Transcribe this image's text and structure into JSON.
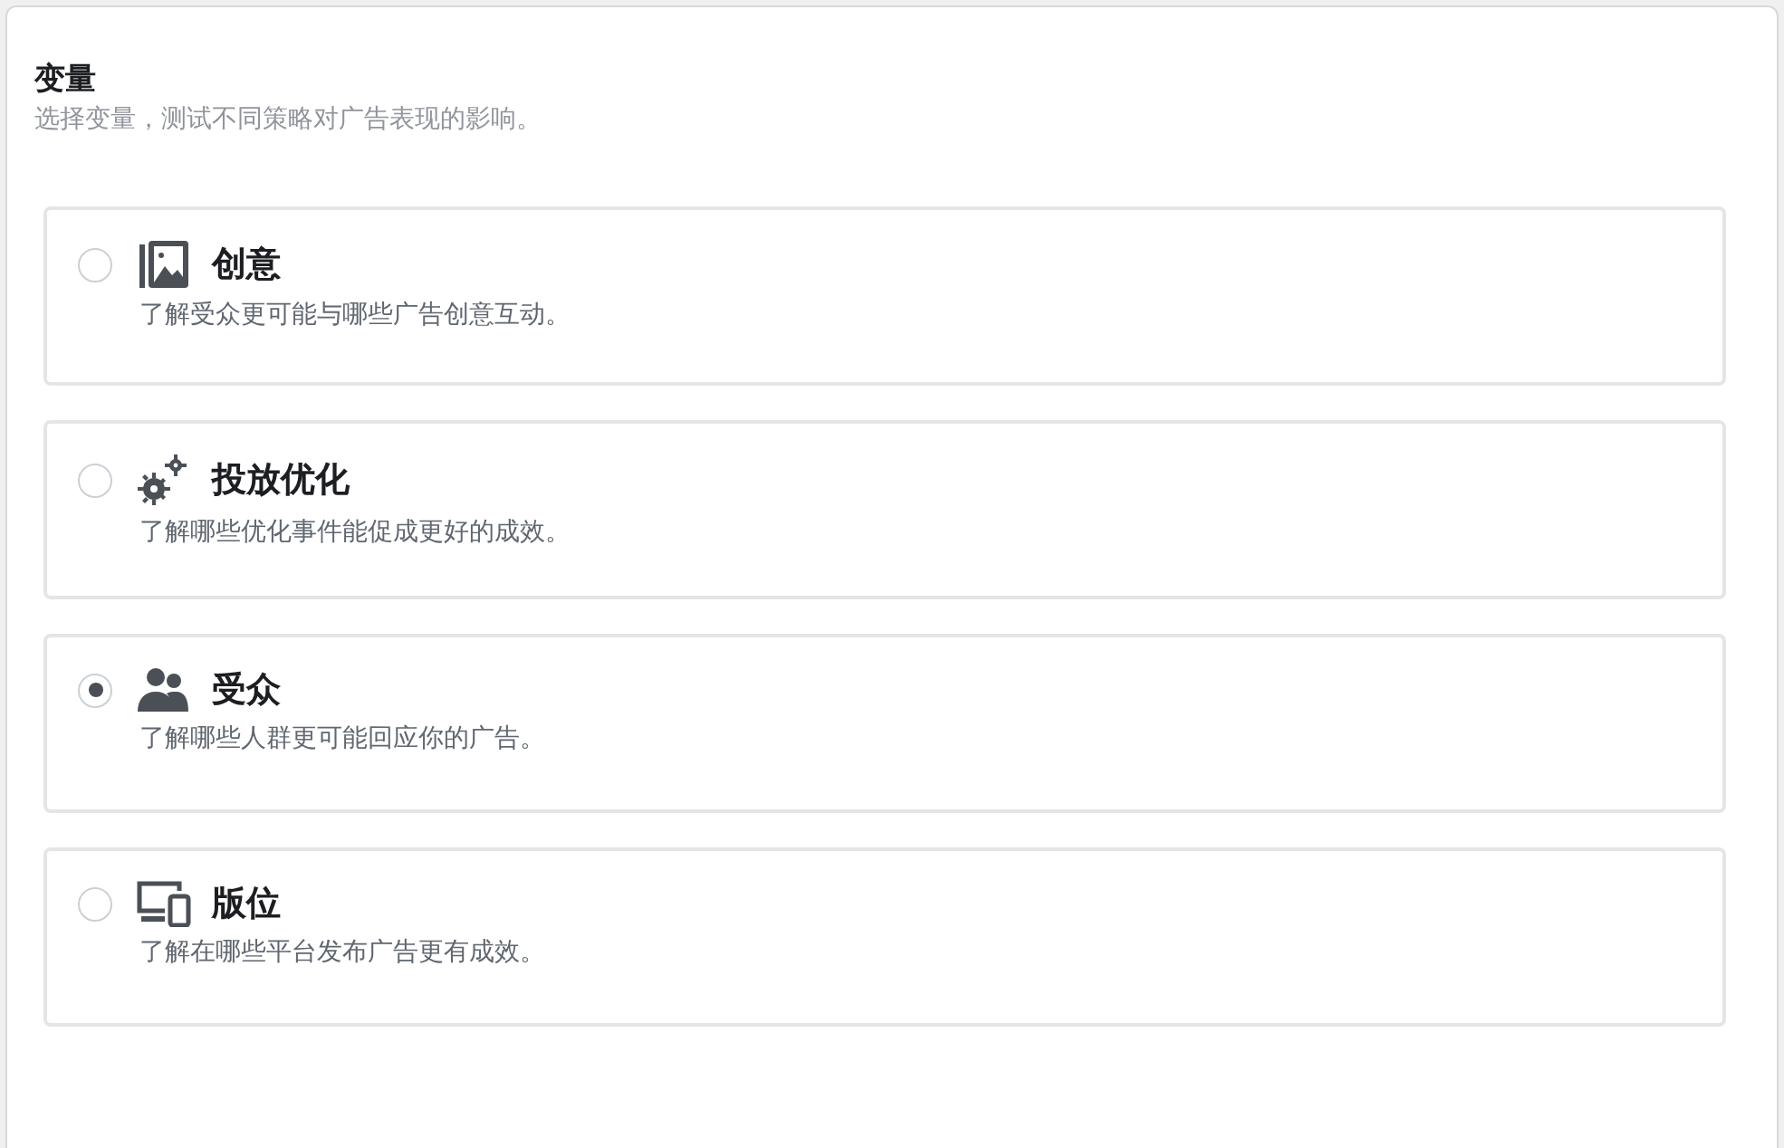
{
  "section": {
    "title": "变量",
    "subtitle": "选择变量，测试不同策略对广告表现的影响。"
  },
  "options": [
    {
      "kind": "image",
      "label": "创意",
      "description": "了解受众更可能与哪些广告创意互动。",
      "selected": false
    },
    {
      "kind": "gears",
      "label": "投放优化",
      "description": "了解哪些优化事件能促成更好的成效。",
      "selected": false
    },
    {
      "kind": "people",
      "label": "受众",
      "description": "了解哪些人群更可能回应你的广告。",
      "selected": true
    },
    {
      "kind": "devices",
      "label": "版位",
      "description": "了解在哪些平台发布广告更有成效。",
      "selected": false
    }
  ]
}
